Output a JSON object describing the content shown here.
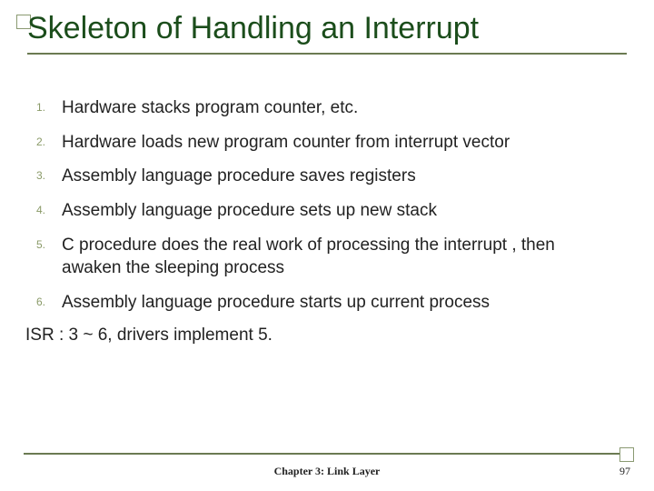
{
  "slide": {
    "title": "Skeleton of Handling an Interrupt",
    "items": [
      {
        "num": "1.",
        "text": "Hardware stacks program counter, etc."
      },
      {
        "num": "2.",
        "text": "Hardware loads new program counter from interrupt vector"
      },
      {
        "num": "3.",
        "text": "Assembly language procedure saves registers"
      },
      {
        "num": "4.",
        "text": "Assembly language procedure sets up new stack"
      },
      {
        "num": "5.",
        "text": "C procedure does the real work of processing the interrupt , then awaken the sleeping process"
      },
      {
        "num": "6.",
        "text": "Assembly language procedure starts up current process"
      }
    ],
    "footnote": "ISR : 3 ~ 6,  drivers implement 5.",
    "footer": "Chapter 3: Link Layer",
    "page_number": "97"
  }
}
